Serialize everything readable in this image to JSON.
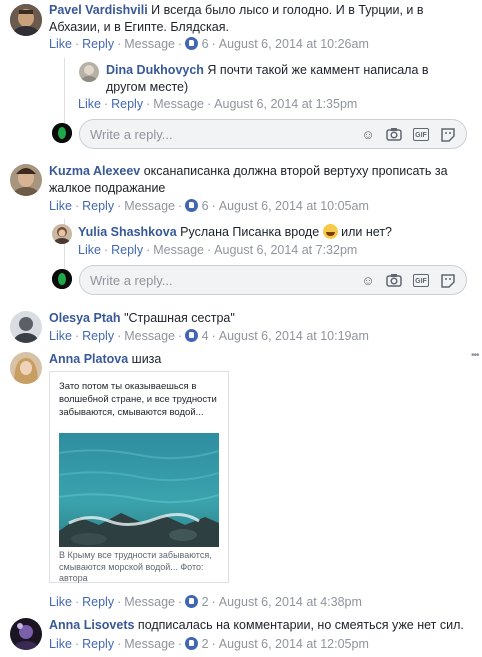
{
  "actions": {
    "like": "Like",
    "reply": "Reply",
    "message": "Message"
  },
  "comments": [
    {
      "author": "Pavel Vardishvili",
      "text": "И всегда было лысо и голодно. И в Турции, и в Абхазии, и в Египте. Блядская.",
      "likes": "6",
      "time": "August 6, 2014 at 10:26am"
    },
    {
      "author": "Dina Dukhovych",
      "text": "Я почти такой же каммент написала в другом месте)",
      "time": "August 6, 2014 at 1:35pm"
    },
    {
      "author": "Kuzma Alexeev",
      "text": "оксанаписанка должна второй вертуху прописать за жалкое подражание",
      "likes": "6",
      "time": "August 6, 2014 at 10:05am"
    },
    {
      "author": "Yulia Shashkova",
      "text_before": "Руслана Писанка вроде",
      "text_after": "или нет?",
      "time": "August 6, 2014 at 7:32pm"
    },
    {
      "author": "Olesya Ptah",
      "text": "\"Страшная сестра\"",
      "likes": "4",
      "time": "August 6, 2014 at 10:19am"
    },
    {
      "author": "Anna Platova",
      "text": "шиза",
      "attachment": {
        "top_text": "Зато потом ты оказываешься в волшебной стране, и все трудности забываются, смываются водой...",
        "caption": "В Крыму все трудности забываются, смываются морской водой... Фото: автора"
      },
      "likes": "2",
      "time": "August 6, 2014 at 4:38pm"
    },
    {
      "author": "Anna Lisovets",
      "text": "подписалась на комментарии, но смеяться уже нет сил.",
      "likes": "2",
      "time": "August 6, 2014 at 12:05pm"
    }
  ],
  "reply_box": {
    "placeholder": "Write a reply..."
  },
  "icons": {
    "emoji": "smiley-icon",
    "camera": "camera-icon",
    "gif": "GIF",
    "sticker": "sticker-icon"
  },
  "colors": {
    "link": "#4267b2",
    "author": "#385898",
    "meta": "#90949c"
  }
}
